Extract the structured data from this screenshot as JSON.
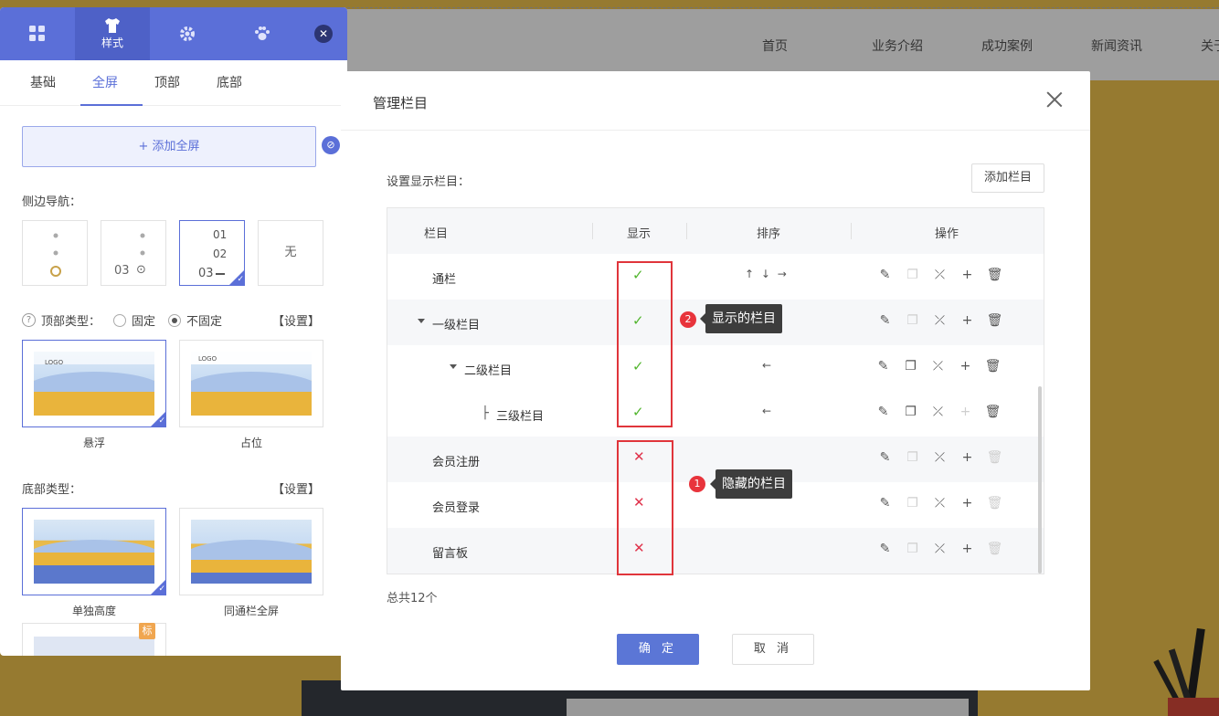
{
  "site": {
    "nav": [
      "首页",
      "业务介绍",
      "成功案例",
      "新闻资讯",
      "关于我"
    ]
  },
  "panel": {
    "toolbar": [
      {
        "icon": "grid-icon",
        "label": ""
      },
      {
        "icon": "shirt-icon",
        "label": "样式"
      },
      {
        "icon": "gear-icon",
        "label": ""
      },
      {
        "icon": "paw-icon",
        "label": ""
      }
    ],
    "tabs": [
      "基础",
      "全屏",
      "顶部",
      "底部"
    ],
    "active_tab": "全屏",
    "add_full_label": "+ 添加全屏",
    "side_nav_label": "侧边导航：",
    "side_nav_options": [
      {
        "label": "",
        "selected": false
      },
      {
        "label": "03 ⊙",
        "selected": false
      },
      {
        "label": "01 02 03",
        "selected": true
      },
      {
        "label": "无",
        "selected": false
      }
    ],
    "nav_opt3_lines": [
      "01",
      "02",
      "03"
    ],
    "nav_opt2_text": "03",
    "top_type_label": "顶部类型：",
    "top_type_options": [
      "固定",
      "不固定"
    ],
    "top_type_selected": "不固定",
    "settings_label": "【设置】",
    "top_thumbs": [
      {
        "caption": "悬浮",
        "logo": "LOGO",
        "selected": true
      },
      {
        "caption": "占位",
        "logo": "LOGO",
        "selected": false
      }
    ],
    "bottom_type_label": "底部类型：",
    "bottom_thumbs": [
      {
        "caption": "单独高度",
        "selected": true
      },
      {
        "caption": "同通栏全屏",
        "selected": false
      }
    ],
    "badge": "标"
  },
  "modal": {
    "title": "管理栏目",
    "set_label": "设置显示栏目：",
    "add_button": "添加栏目",
    "columns": [
      "栏目",
      "显示",
      "排序",
      "操作"
    ],
    "rows": [
      {
        "name": "通栏",
        "visible": true,
        "sort": "↑ ↓ →",
        "copy_enabled": false,
        "add_enabled": true,
        "delete_enabled": true
      },
      {
        "name": "一级栏目",
        "visible": true,
        "sort": "",
        "copy_enabled": false,
        "add_enabled": true,
        "delete_enabled": true
      },
      {
        "name": "二级栏目",
        "visible": true,
        "sort": "←",
        "copy_enabled": true,
        "add_enabled": true,
        "delete_enabled": true
      },
      {
        "name": "三级栏目",
        "visible": true,
        "sort": "←",
        "copy_enabled": true,
        "add_enabled": false,
        "delete_enabled": true
      },
      {
        "name": "会员注册",
        "visible": false,
        "sort": "",
        "copy_enabled": false,
        "add_enabled": true,
        "delete_enabled": false
      },
      {
        "name": "会员登录",
        "visible": false,
        "sort": "",
        "copy_enabled": false,
        "add_enabled": true,
        "delete_enabled": false
      },
      {
        "name": "留言板",
        "visible": false,
        "sort": "",
        "copy_enabled": false,
        "add_enabled": true,
        "delete_enabled": false
      }
    ],
    "tree_prefix_level3": "├",
    "callout_shown": {
      "num": "2",
      "text": "显示的栏目"
    },
    "callout_hidden": {
      "num": "1",
      "text": "隐藏的栏目"
    },
    "total": "总共12个",
    "confirm": "确 定",
    "cancel": "取 消"
  },
  "colors": {
    "accent": "#5b6fd8",
    "check": "#52b52e",
    "cross": "#e0344c",
    "highlight": "#e0353b"
  }
}
